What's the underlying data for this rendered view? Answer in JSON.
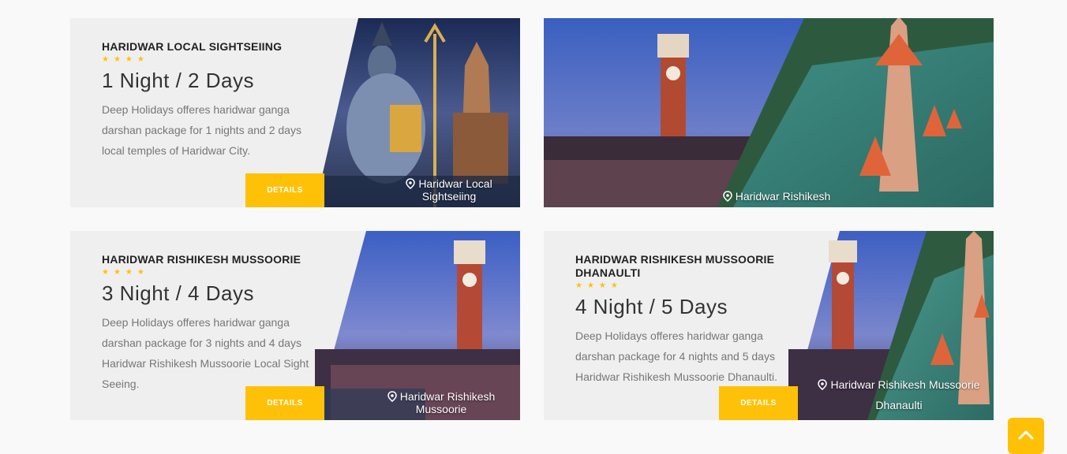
{
  "cards": [
    {
      "title": "HARIDWAR LOCAL SIGHTSEIING",
      "stars": "★★★★",
      "duration": "1 Night / 2 Days",
      "description": "Deep Holidays offeres haridwar ganga darshan package for 1 nights and 2 days local temples of Haridwar City.",
      "button_label": "DETAILS",
      "location": "Haridwar Local Sightseiing"
    },
    {
      "location": "Haridwar Rishikesh"
    },
    {
      "title": "HARIDWAR RISHIKESH MUSSOORIE",
      "stars": "★★★★",
      "duration": "3 Night / 4 Days",
      "description": "Deep Holidays offeres haridwar ganga darshan package for 3 nights and 4 days Haridwar Rishikesh Mussoorie Local Sight Seeing.",
      "button_label": "DETAILS",
      "location": "Haridwar Rishikesh Mussoorie"
    },
    {
      "title": "HARIDWAR RISHIKESH MUSSOORIE DHANAULTI",
      "stars": "★★★★",
      "duration": "4 Night / 5 Days",
      "description": "Deep Holidays offeres haridwar ganga darshan package for 4 nights and 5 days Haridwar Rishikesh Mussoorie Dhanaulti.",
      "button_label": "DETAILS",
      "location": "Haridwar Rishikesh Mussoorie Dhanaulti"
    }
  ],
  "icons": {
    "location": "map-pin-icon",
    "scroll_top": "chevron-up-icon"
  },
  "colors": {
    "accent": "#ffc107",
    "card_bg": "#efefef",
    "page_bg": "#f9f9f9"
  }
}
